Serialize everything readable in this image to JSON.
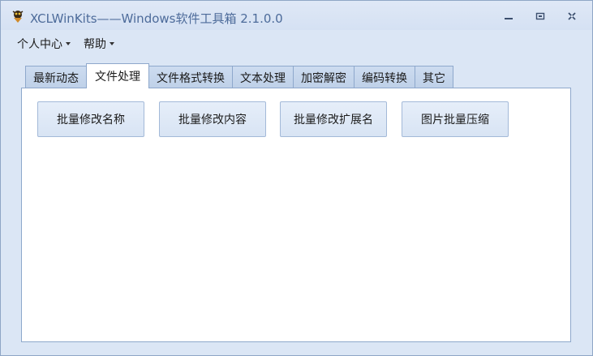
{
  "window": {
    "title": "XCLWinKits——Windows软件工具箱 2.1.0.0",
    "app_icon": "app-logo-icon",
    "controls": [
      "minimize-icon",
      "restore-icon",
      "close-icon"
    ]
  },
  "menu": {
    "items": [
      {
        "label": "个人中心"
      },
      {
        "label": "帮助"
      }
    ]
  },
  "tabs": [
    {
      "label": "最新动态"
    },
    {
      "label": "文件处理"
    },
    {
      "label": "文件格式转换"
    },
    {
      "label": "文本处理"
    },
    {
      "label": "加密解密"
    },
    {
      "label": "编码转换"
    },
    {
      "label": "其它"
    }
  ],
  "active_tab": "文件处理",
  "panel": {
    "buttons": [
      {
        "label": "批量修改名称"
      },
      {
        "label": "批量修改内容"
      },
      {
        "label": "批量修改扩展名"
      },
      {
        "label": "图片批量压缩"
      }
    ]
  },
  "colors": {
    "title_text": "#4d6b9a",
    "window_bg": "#dbe6f5",
    "tab_border": "#8ea8cc",
    "button_bg": "#dde7f6"
  }
}
